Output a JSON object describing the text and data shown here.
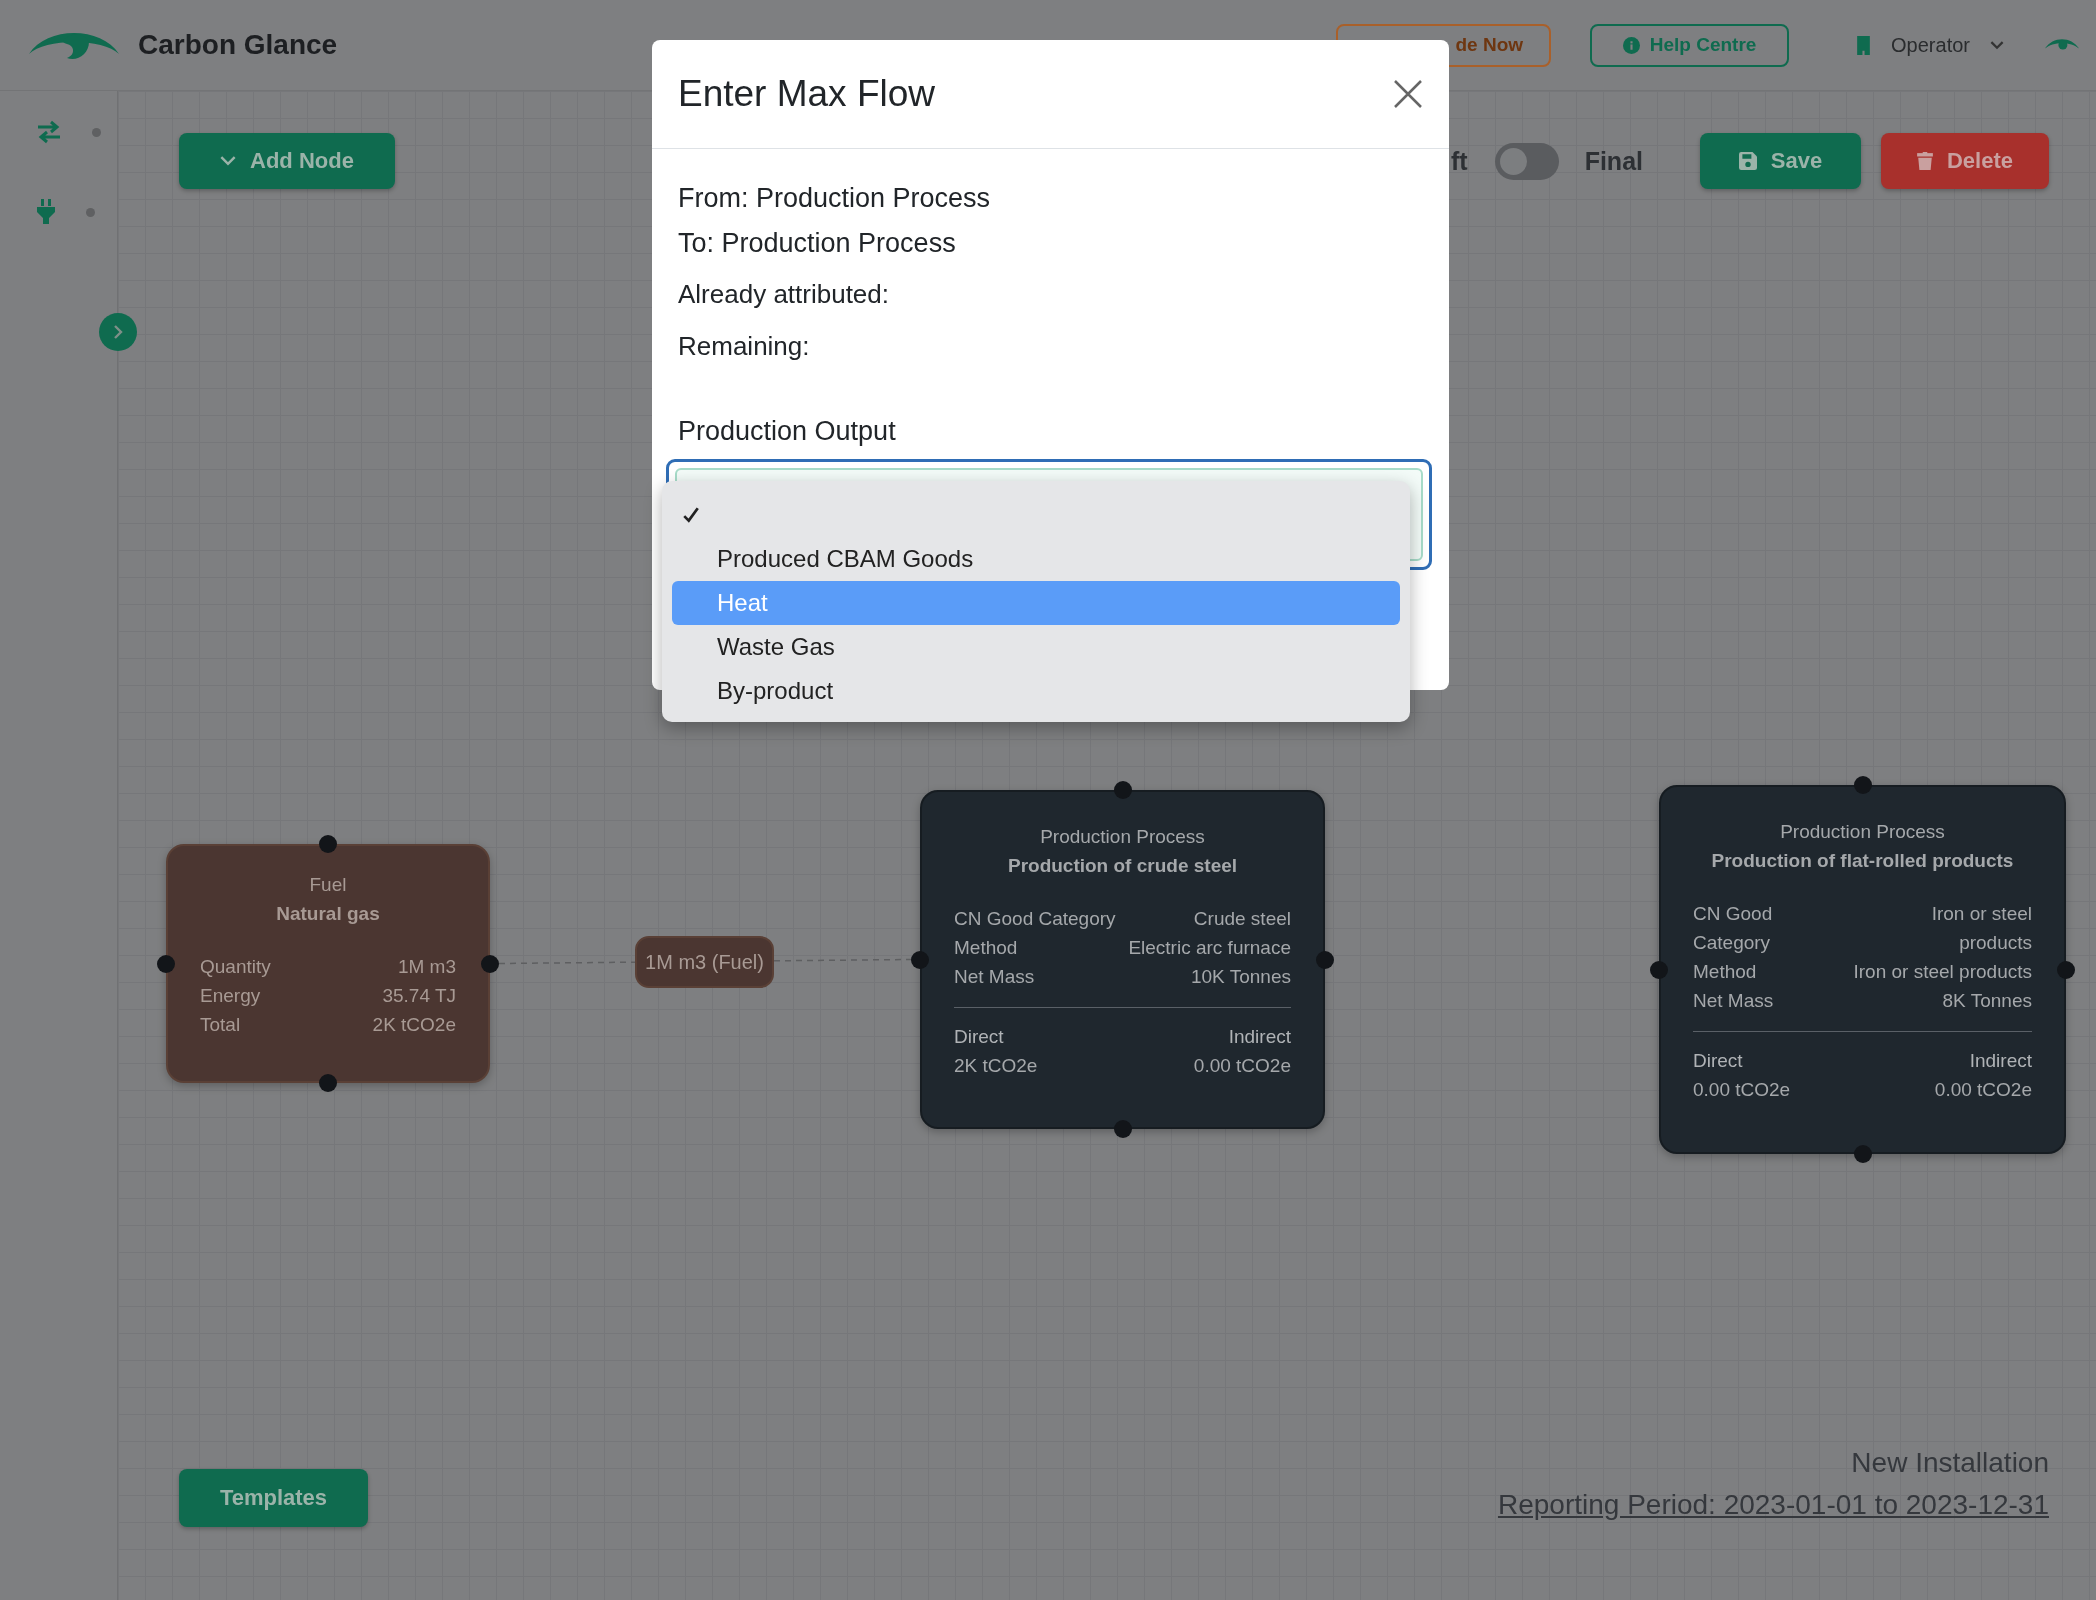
{
  "header": {
    "brand": "Carbon Glance",
    "upgrade_button": "de Now",
    "help_button": "Help Centre",
    "user_menu": "Operator"
  },
  "toolbar": {
    "add_node_button": "Add Node",
    "status_toggle": {
      "left_label": "ft",
      "right_label": "Final",
      "on": false
    },
    "save_button": "Save",
    "delete_button": "Delete"
  },
  "canvas": {
    "nodes": [
      {
        "kind": "fuel",
        "type_label": "Fuel",
        "name": "Natural gas",
        "fields": [
          {
            "label": "Quantity",
            "value": "1M m3"
          },
          {
            "label": "Energy",
            "value": "35.74 TJ"
          },
          {
            "label": "Total",
            "value": "2K tCO2e"
          }
        ]
      },
      {
        "kind": "process",
        "type_label": "Production Process",
        "name": "Production of crude steel",
        "fields": [
          {
            "label": "CN Good Category",
            "value": "Crude steel"
          },
          {
            "label": "Method",
            "value": "Electric arc furnace"
          },
          {
            "label": "Net Mass",
            "value": "10K Tonnes"
          }
        ],
        "emissions": [
          {
            "label": "Direct",
            "value": "2K tCO2e"
          },
          {
            "label": "Indirect",
            "value": "0.00 tCO2e"
          }
        ]
      },
      {
        "kind": "process",
        "type_label": "Production Process",
        "name": "Production of flat-rolled products",
        "fields": [
          {
            "label": "CN Good Category",
            "value": "Iron or steel products"
          },
          {
            "label": "Method",
            "value": "Iron or steel products"
          },
          {
            "label": "Net Mass",
            "value": "8K Tonnes"
          }
        ],
        "emissions": [
          {
            "label": "Direct",
            "value": "0.00 tCO2e"
          },
          {
            "label": "Indirect",
            "value": "0.00 tCO2e"
          }
        ]
      }
    ],
    "edges": [
      {
        "label": "1M m3 (Fuel)"
      }
    ]
  },
  "templates_button": "Templates",
  "installation": {
    "name": "New Installation",
    "reporting_period": "Reporting Period: 2023-01-01 to 2023-12-31"
  },
  "modal": {
    "title": "Enter Max Flow",
    "from": "From: Production Process",
    "to": "To: Production Process",
    "already_attributed": "Already attributed:",
    "remaining": "Remaining:",
    "production_output": {
      "label": "Production Output",
      "options": [
        {
          "checked": true,
          "highlighted": false
        },
        {
          "label": "Produced CBAM Goods",
          "checked": false,
          "highlighted": false
        },
        {
          "label": "Heat",
          "checked": false,
          "highlighted": true
        },
        {
          "label": "Waste Gas",
          "checked": false,
          "highlighted": false
        },
        {
          "label": "By-product",
          "checked": false,
          "highlighted": false
        }
      ]
    }
  }
}
